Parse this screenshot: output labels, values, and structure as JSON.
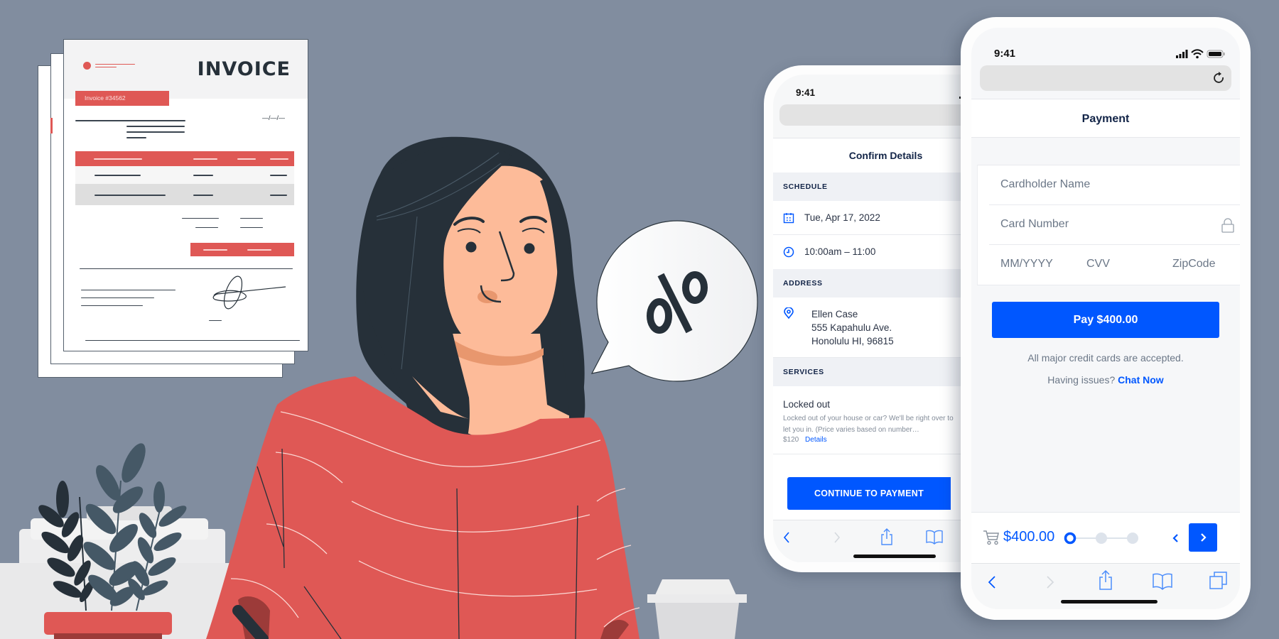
{
  "invoice": {
    "title": "INVOICE",
    "number_label": "Invoice  #34562",
    "date_placeholder": "—/—/—"
  },
  "speech_bubble": {
    "symbol": "%"
  },
  "confirm_phone": {
    "status_time": "9:41",
    "page_title": "Confirm Details",
    "schedule": {
      "heading": "SCHEDULE",
      "date": "Tue, Apr 17, 2022",
      "time": "10:00am – 11:00"
    },
    "address": {
      "heading": "ADDRESS",
      "name": "Ellen Case",
      "street": "555 Kapahulu Ave.",
      "city": "Honolulu HI, 96815"
    },
    "services": {
      "heading": "SERVICES",
      "items": [
        {
          "name": "Locked out",
          "description": "Locked out of your house or car? We'll be right over to let you in. (Price varies based on number…",
          "price": "$120",
          "details_link": "Details"
        }
      ]
    },
    "continue_button": "CONTINUE TO PAYMENT"
  },
  "payment_phone": {
    "status_time": "9:41",
    "page_title": "Payment",
    "fields": {
      "cardholder_placeholder": "Cardholder Name",
      "card_number_placeholder": "Card Number",
      "expiry_placeholder": "MM/YYYY",
      "cvv_placeholder": "CVV",
      "zip_placeholder": "ZipCode"
    },
    "pay_button": "Pay $400.00",
    "cards_note": "All major credit cards are accepted.",
    "issues_prefix": "Having issues?",
    "chat_link": "Chat Now",
    "cart_total": "$400.00",
    "progress": {
      "current_step": 1,
      "total_steps": 3
    }
  },
  "colors": {
    "accent_blue": "#0057ff",
    "invoice_red": "#df5855",
    "background": "#818d9f",
    "navy_text": "#122447"
  }
}
